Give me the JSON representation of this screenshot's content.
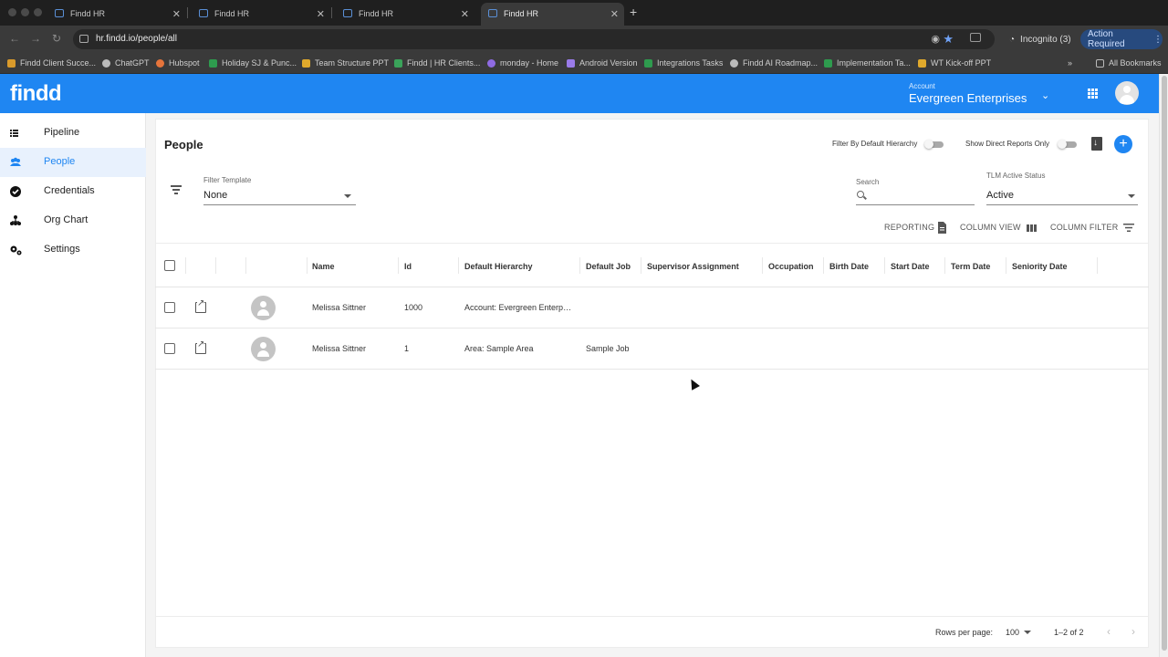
{
  "browser": {
    "tabs": [
      {
        "title": "Findd HR",
        "active": false
      },
      {
        "title": "Findd HR",
        "active": false
      },
      {
        "title": "Findd HR",
        "active": false
      },
      {
        "title": "Findd HR",
        "active": true
      }
    ],
    "url": "hr.findd.io/people/all",
    "incognito": "Incognito (3)",
    "action_required": "Action Required",
    "bookmarks": [
      {
        "label": "Findd Client Succe...",
        "color": "#d99a2b"
      },
      {
        "label": "ChatGPT",
        "color": "#bbbbbb"
      },
      {
        "label": "Hubspot",
        "color": "#e6743b"
      },
      {
        "label": "Holiday SJ & Punc...",
        "color": "#2e9b4e"
      },
      {
        "label": "Team Structure PPT",
        "color": "#e0a92c"
      },
      {
        "label": "Findd | HR Clients...",
        "color": "#3aa35a"
      },
      {
        "label": "monday - Home",
        "color": "#8f6be3"
      },
      {
        "label": "Android Version",
        "color": "#9a7be9"
      },
      {
        "label": "Integrations Tasks",
        "color": "#2e9b4e"
      },
      {
        "label": "Findd AI Roadmap...",
        "color": "#bbbbbb"
      },
      {
        "label": "Implementation Ta...",
        "color": "#2e9b4e"
      },
      {
        "label": "WT Kick-off PPT",
        "color": "#e0a92c"
      }
    ],
    "all_bookmarks": "All Bookmarks"
  },
  "app": {
    "logo": "findd",
    "account_label": "Account",
    "account_name": "Evergreen Enterprises",
    "brand_color": "#1f86f2"
  },
  "sidebar": {
    "items": [
      {
        "label": "Pipeline",
        "icon": "list-icon",
        "active": false
      },
      {
        "label": "People",
        "icon": "people-icon",
        "active": true
      },
      {
        "label": "Credentials",
        "icon": "check-badge-icon",
        "active": false
      },
      {
        "label": "Org Chart",
        "icon": "org-chart-icon",
        "active": false
      },
      {
        "label": "Settings",
        "icon": "gear-icon",
        "active": false
      }
    ]
  },
  "page": {
    "title": "People",
    "toggle_hierarchy_label": "Filter By Default Hierarchy",
    "toggle_direct_label": "Show Direct Reports Only",
    "filter_template_label": "Filter Template",
    "filter_template_value": "None",
    "search_label": "Search",
    "search_value": "",
    "tlm_label": "TLM Active Status",
    "tlm_value": "Active",
    "reporting": "REPORTING",
    "column_view": "COLUMN VIEW",
    "column_filter": "COLUMN FILTER"
  },
  "table": {
    "columns": [
      "Name",
      "Id",
      "Default Hierarchy",
      "Default Job",
      "Supervisor Assignment",
      "Occupation",
      "Birth Date",
      "Start Date",
      "Term Date",
      "Seniority Date"
    ],
    "rows": [
      {
        "name": "Melissa Sittner",
        "id": "1000",
        "hierarchy": "Account: Evergreen Enterprises",
        "job": ""
      },
      {
        "name": "Melissa Sittner",
        "id": "1",
        "hierarchy": "Area: Sample Area",
        "job": "Sample Job"
      }
    ]
  },
  "pagination": {
    "rows_per_page_label": "Rows per page:",
    "rows_per_page": "100",
    "range": "1–2 of 2"
  }
}
